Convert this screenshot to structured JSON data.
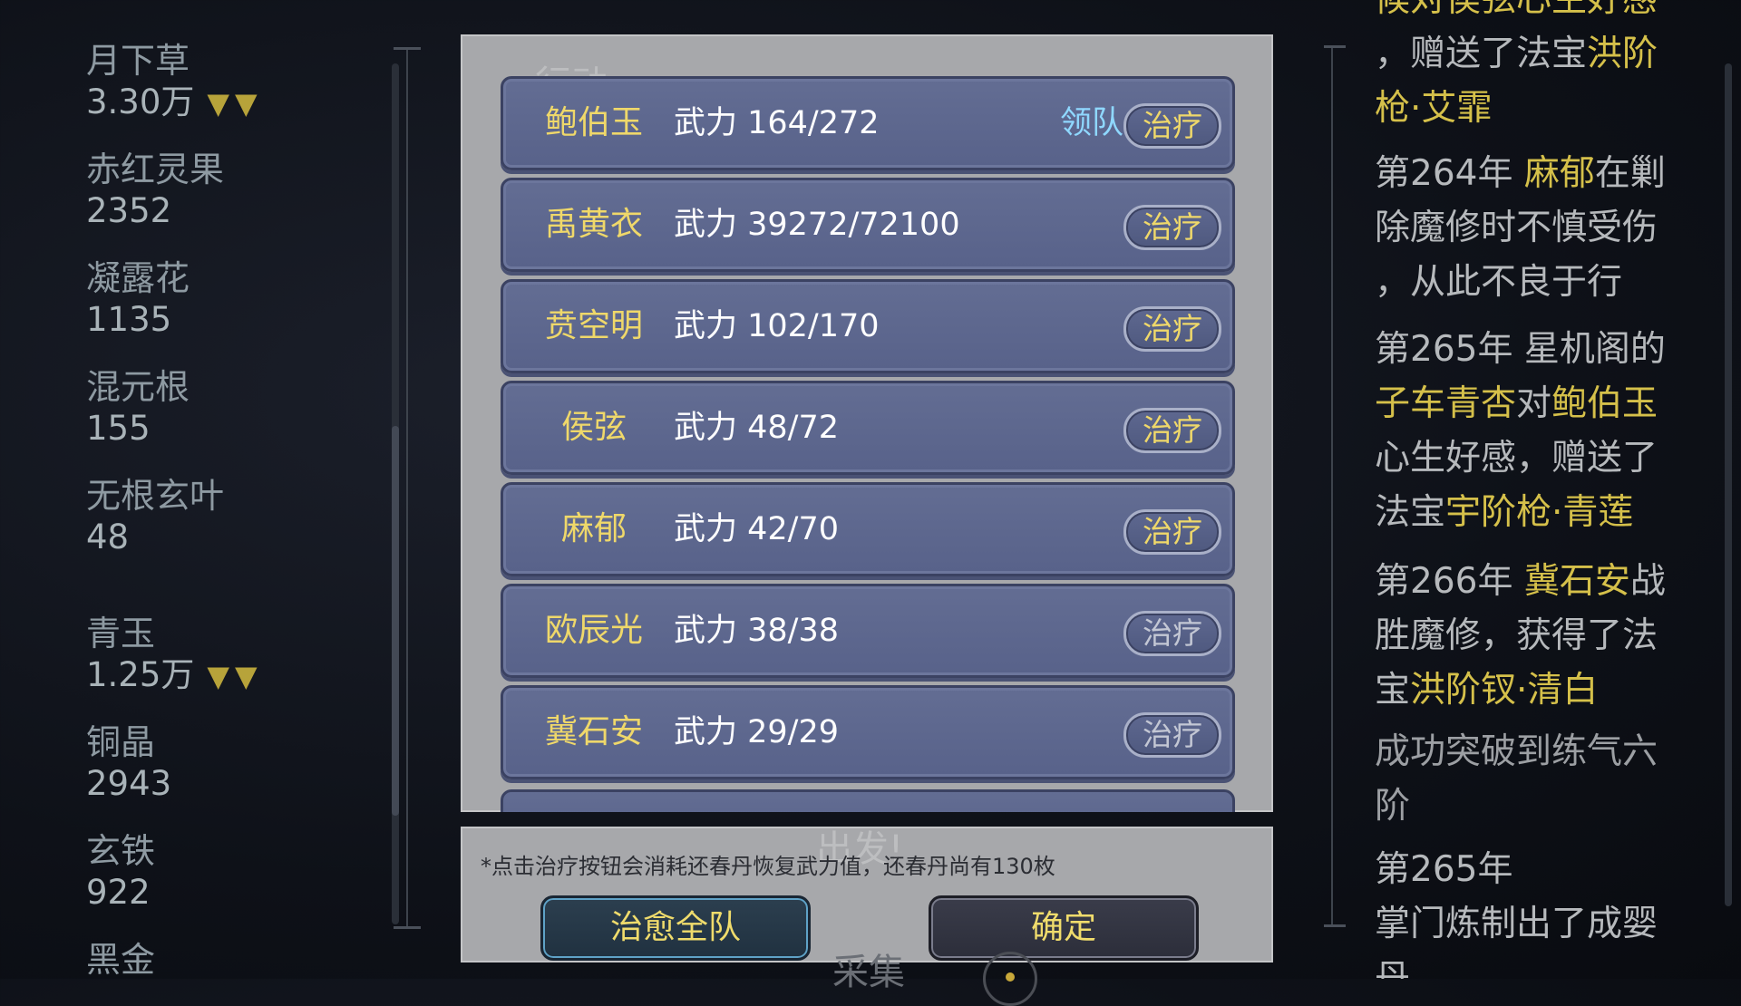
{
  "resources": [
    {
      "name": "月下草",
      "value": "3.30万",
      "arrows": "▼▼"
    },
    {
      "name": "赤红灵果",
      "value": "2352",
      "arrows": ""
    },
    {
      "name": "凝露花",
      "value": "1135",
      "arrows": ""
    },
    {
      "name": "混元根",
      "value": "155",
      "arrows": ""
    },
    {
      "name": "无根玄叶",
      "value": "48",
      "arrows": ""
    },
    {
      "name": "青玉",
      "value": "1.25万",
      "arrows": "▼▼"
    },
    {
      "name": "铜晶",
      "value": "2943",
      "arrows": ""
    },
    {
      "name": "玄铁",
      "value": "922",
      "arrows": ""
    },
    {
      "name": "黑金",
      "value": "",
      "arrows": ""
    }
  ],
  "log": {
    "e0_line1_hl": "候对侯弦心生好感",
    "e0_line2a": "，赠送了法宝",
    "e0_line2b": "洪阶",
    "e0_line3": "枪·艾霏",
    "e1_year": "第264年 ",
    "e1_name": "麻郁",
    "e1_rest1": "在剿",
    "e1_line2": "除魔修时不慎受伤",
    "e1_line3": "，从此不良于行",
    "e2_line1": "第265年 星机阁的",
    "e2_name1": "子车青杏",
    "e2_mid": "对",
    "e2_name2": "鲍伯玉",
    "e2_line3": "心生好感，赠送了",
    "e2_line4a": "法宝",
    "e2_line4b": "宇阶枪·青莲",
    "e3_year": "第266年 ",
    "e3_name": "冀石安",
    "e3_rest1": "战",
    "e3_line2": "胜魔修，获得了法",
    "e3_line3a": "宝",
    "e3_line3b": "洪阶钗·清白",
    "e4_line1": "成功突破到练气六",
    "e4_line2": "阶",
    "e5_line1": "第265年",
    "e5_line2": "掌门炼制出了成婴",
    "e5_line3": "丹"
  },
  "dialog": {
    "bg_tab": "行动",
    "bg_start": "出发!",
    "bg_collect": "采集",
    "power_label": "武力",
    "leader_label": "领队",
    "heal_label": "治疗",
    "members": [
      {
        "name": "鲍伯玉",
        "power": "武力 164/272",
        "leader": "领队",
        "heal_enabled": true
      },
      {
        "name": "禹黄衣",
        "power": "武力 39272/72100",
        "leader": "",
        "heal_enabled": true
      },
      {
        "name": "贲空明",
        "power": "武力 102/170",
        "leader": "",
        "heal_enabled": true
      },
      {
        "name": "侯弦",
        "power": "武力 48/72",
        "leader": "",
        "heal_enabled": true
      },
      {
        "name": "麻郁",
        "power": "武力 42/70",
        "leader": "",
        "heal_enabled": true
      },
      {
        "name": "欧辰光",
        "power": "武力 38/38",
        "leader": "",
        "heal_enabled": false
      },
      {
        "name": "冀石安",
        "power": "武力 29/29",
        "leader": "",
        "heal_enabled": false
      }
    ],
    "note": "*点击治疗按钮会消耗还春丹恢复武力值，还春丹尚有130枚",
    "heal_all_label": "治愈全队",
    "confirm_label": "确定"
  },
  "colors": {
    "accent_gold": "#efd86a",
    "leader_blue": "#8fd8ff",
    "row_bg": "#5e688f",
    "dialog_bg": "#a7a8ab"
  }
}
